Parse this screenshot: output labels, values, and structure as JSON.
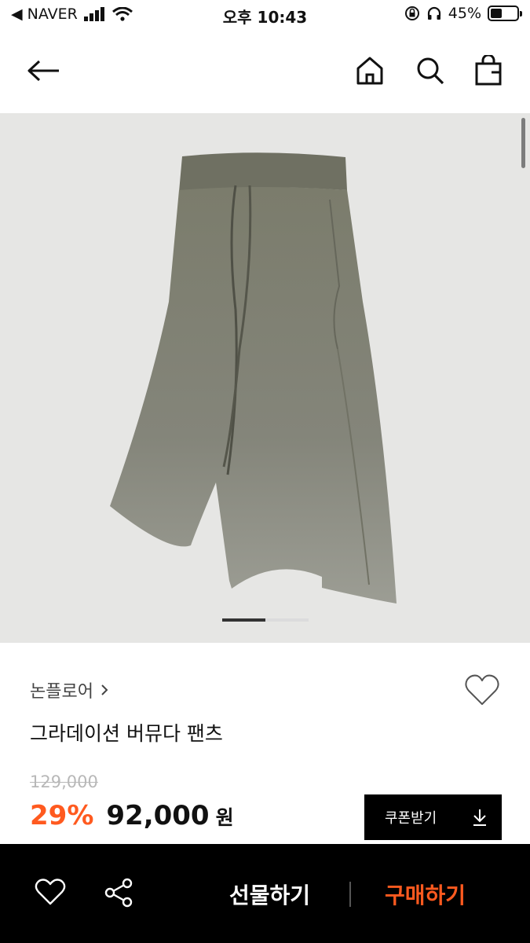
{
  "status_bar": {
    "back_app": "◀ NAVER",
    "time": "오후 10:43",
    "battery": "45%"
  },
  "nav": {
    "back_icon": "back-arrow-icon",
    "home_icon": "home-icon",
    "search_icon": "search-icon",
    "cart_icon": "shopping-bag-icon"
  },
  "product": {
    "brand": "논플로어",
    "name": "그라데이션 버뮤다 팬츠",
    "original_price": "129,000",
    "discount": "29%",
    "sale_price": "92,000",
    "currency": "원",
    "image_page": 1,
    "image_pages": 2
  },
  "coupon": {
    "label": "쿠폰받기"
  },
  "bottom_bar": {
    "gift_label": "선물하기",
    "buy_label": "구매하기"
  },
  "colors": {
    "accent": "#ff5a1f",
    "bottom_bar": "#000000",
    "image_bg": "#e6e6e4"
  }
}
